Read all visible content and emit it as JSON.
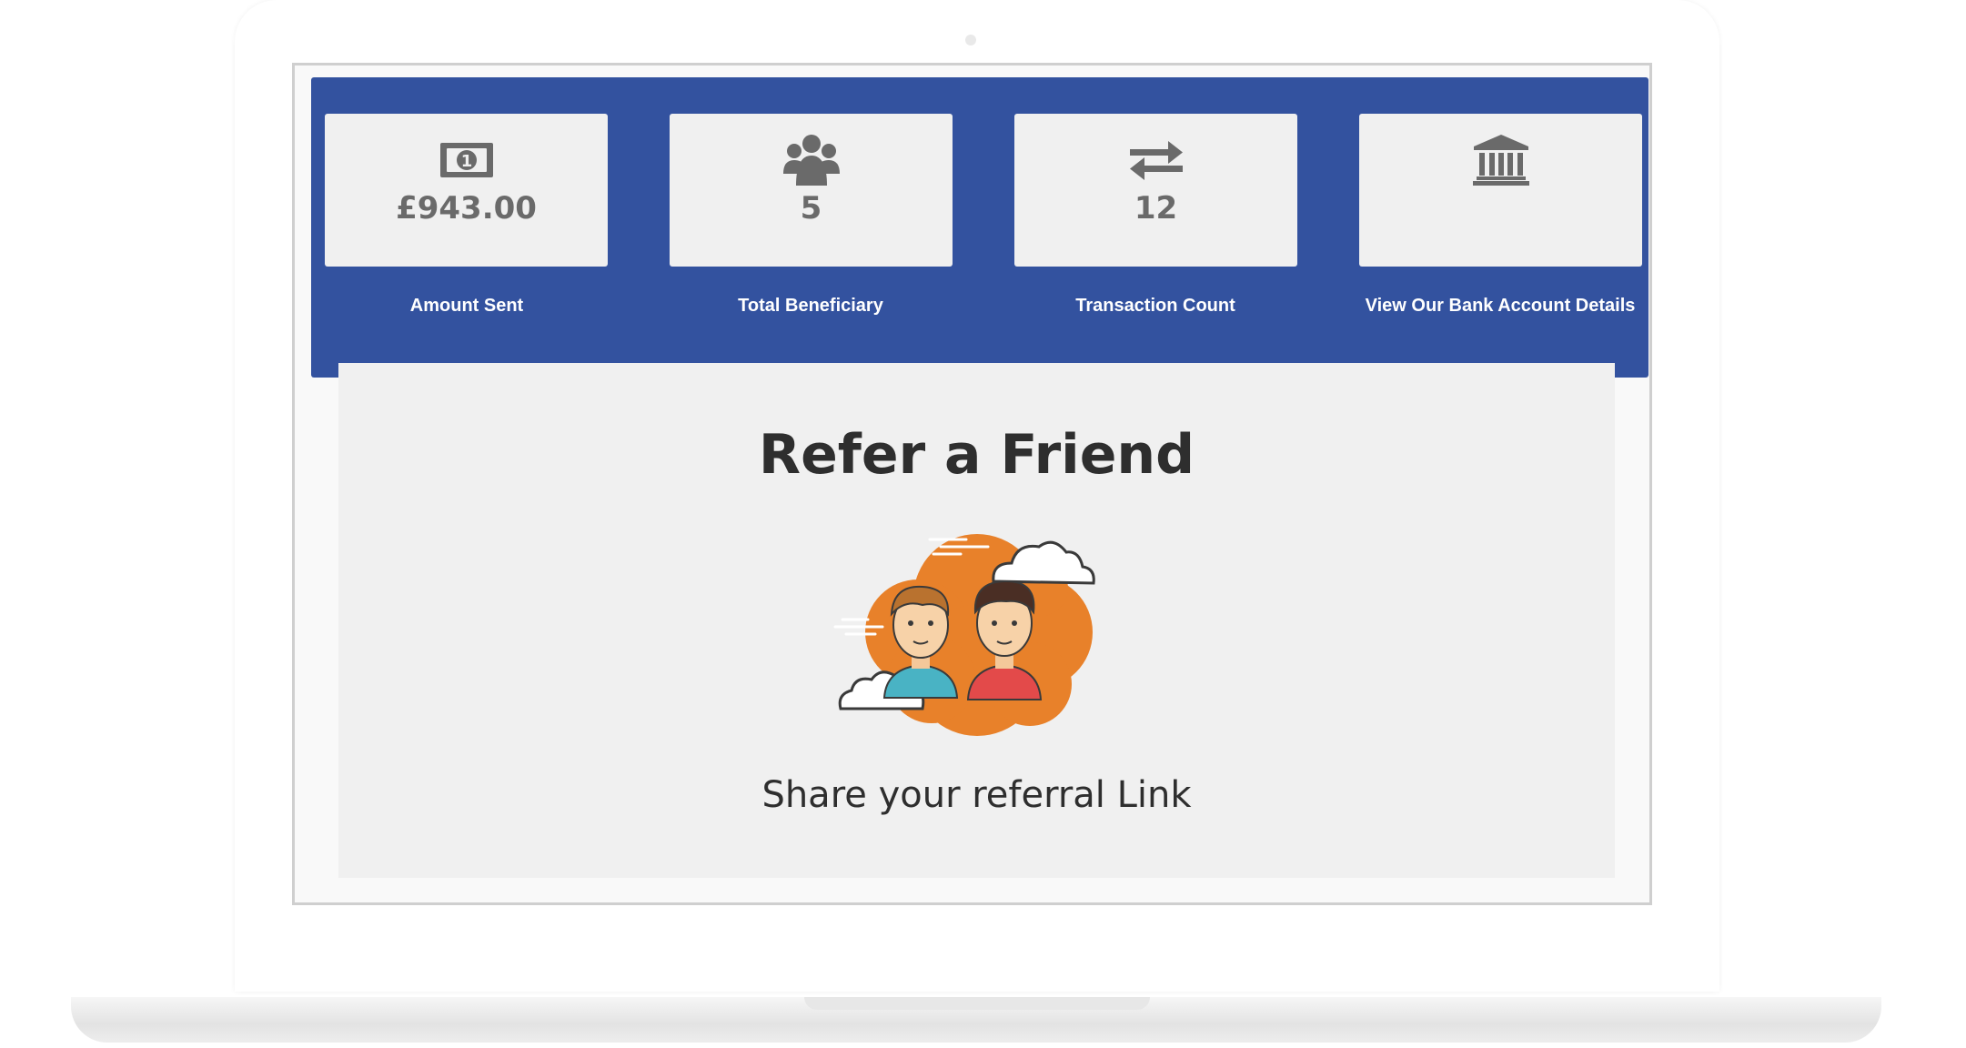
{
  "stats": [
    {
      "label": "Amount Sent",
      "value": "£943.00",
      "icon": "money-bill-icon"
    },
    {
      "label": "Total Beneficiary",
      "value": "5",
      "icon": "users-icon"
    },
    {
      "label": "Transaction Count",
      "value": "12",
      "icon": "exchange-arrows-icon"
    },
    {
      "label": "View Our Bank Account Details",
      "value": "",
      "icon": "bank-icon"
    }
  ],
  "refer": {
    "title": "Refer a Friend",
    "subtitle": "Share your referral Link",
    "illustration": "two-friends-illustration"
  },
  "colors": {
    "panel_blue": "#33529f",
    "card_bg": "#f0f0f0",
    "icon_gray": "#6a6a6a",
    "illustration_orange": "#e8812a"
  }
}
